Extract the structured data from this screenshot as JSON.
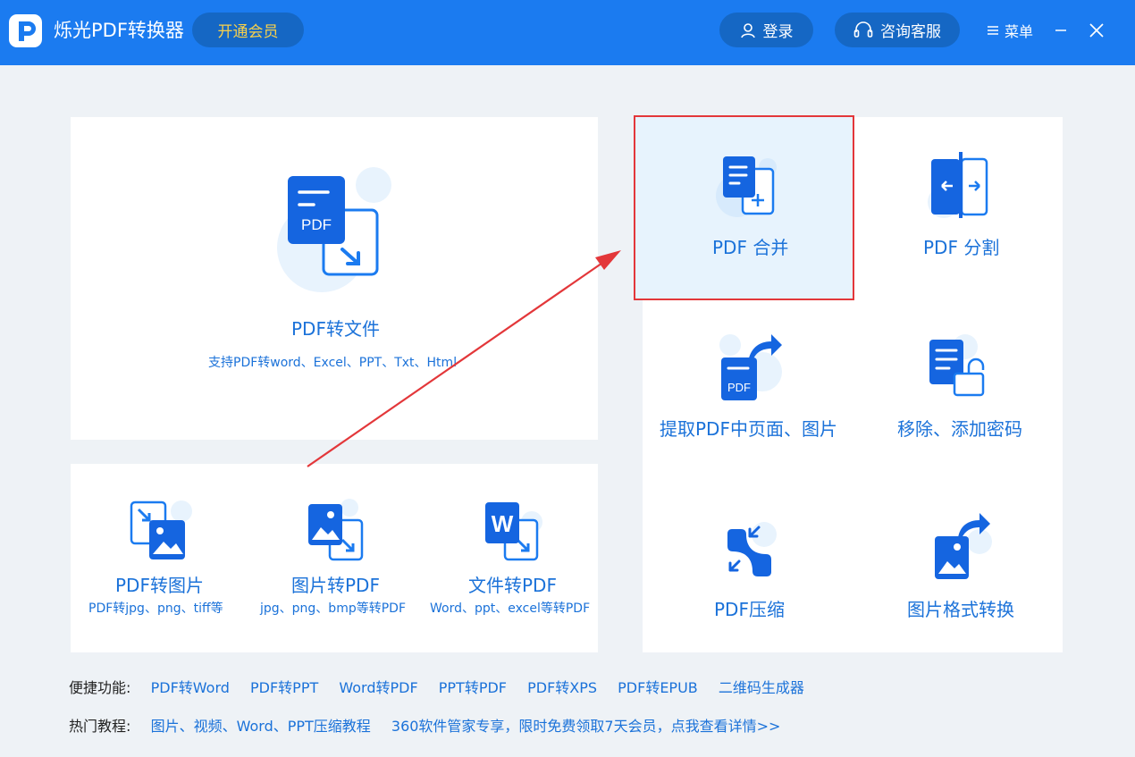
{
  "app": {
    "title": "烁光PDF转换器",
    "vip_label": "开通会员",
    "login_label": "登录",
    "service_label": "咨询客服",
    "menu_label": "菜单"
  },
  "main": {
    "title": "PDF转文件",
    "desc": "支持PDF转word、Excel、PPT、Txt、Html"
  },
  "small_tools": [
    {
      "title": "PDF转图片",
      "desc": "PDF转jpg、png、tiff等"
    },
    {
      "title": "图片转PDF",
      "desc": "jpg、png、bmp等转PDF"
    },
    {
      "title": "文件转PDF",
      "desc": "Word、ppt、excel等转PDF"
    }
  ],
  "right_tools": [
    {
      "title": "PDF 合并"
    },
    {
      "title": "PDF 分割"
    },
    {
      "title": "提取PDF中页面、图片"
    },
    {
      "title": "移除、添加密码"
    },
    {
      "title": "PDF压缩"
    },
    {
      "title": "图片格式转换"
    }
  ],
  "shortcuts": {
    "label": "便捷功能:",
    "items": [
      "PDF转Word",
      "PDF转PPT",
      "Word转PDF",
      "PPT转PDF",
      "PDF转XPS",
      "PDF转EPUB",
      "二维码生成器"
    ]
  },
  "tutorials": {
    "label": "热门教程:",
    "items": [
      "图片、视频、Word、PPT压缩教程",
      "360软件管家专享，限时免费领取7天会员，点我查看详情>>"
    ]
  },
  "colors": {
    "brand": "#1b7bf0",
    "accent_text": "#1b72d9",
    "highlight_border": "#e3373a",
    "arrow": "#e3373a"
  }
}
